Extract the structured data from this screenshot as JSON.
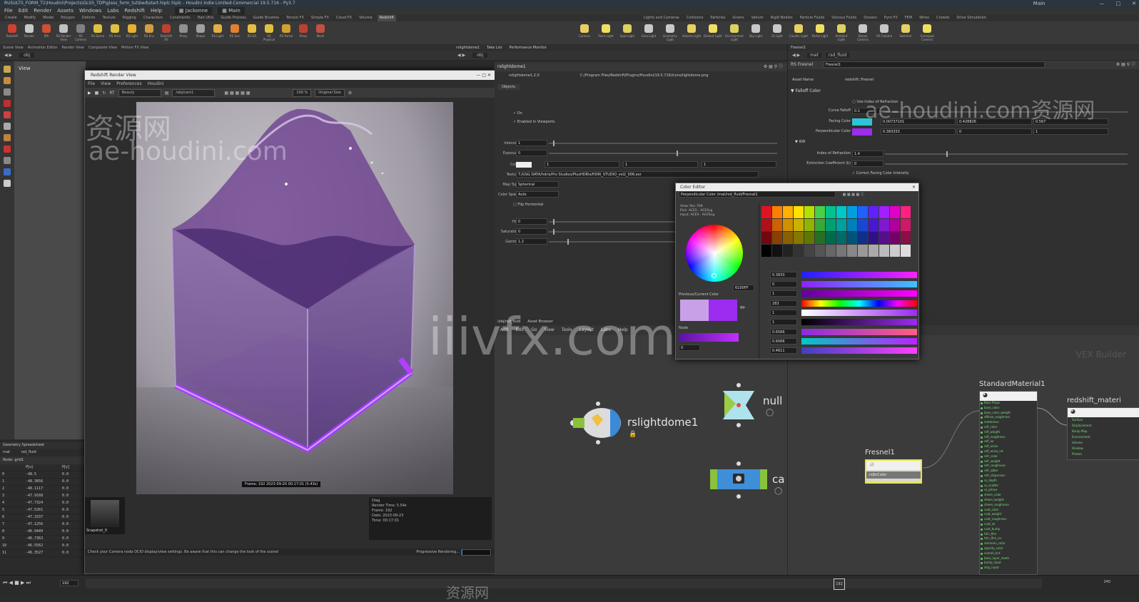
{
  "window": {
    "title": "RUSULTS_FORM_T1\\Houdini\\Projects\\GLSS_TDP\\glass_form_tut\\bed\\start.hiplc.hiplc - Houdini Indie Limited-Commercial 19.5.716 - Py3.7",
    "desktop": "Main"
  },
  "menubar": [
    "File",
    "Edit",
    "Render",
    "Assets",
    "Windows",
    "Labs",
    "Redshift",
    "Help"
  ],
  "menubar_desk": "Jackonne",
  "menubar_desk2": "Main",
  "shelf_tabs": [
    "Create",
    "Modify",
    "Model",
    "Polygon",
    "Deform",
    "Texture",
    "Rigging",
    "Characters",
    "Constraints",
    "Hair Utils",
    "Guide Process",
    "Guide Brushes",
    "Terrain FX",
    "Simple FX",
    "Cloud FX",
    "Volume",
    "Redshift"
  ],
  "shelf_tools": [
    "Redshift",
    "Render",
    "IPR",
    "RS Render View",
    "RS Camera",
    "RS Dome",
    "RS Area",
    "RS Light",
    "RS Env",
    "Redshift RS",
    "Proxy",
    "Shape",
    "RS Light",
    "RS Sun",
    "RS IES",
    "RS Physical",
    "RS Portal",
    "Proxy",
    "Mesh"
  ],
  "right_shelf_tabs": [
    "Lights and Cameras",
    "Collisions",
    "Particles",
    "Grains",
    "Vellum",
    "Rigid Bodies",
    "Particle Fluids",
    "Viscous Fluids",
    "Oceans",
    "Pyro FX",
    "FEM",
    "Wires",
    "Crowds",
    "Drive Simulation"
  ],
  "right_shelf_tools": [
    "Camera",
    "Point Light",
    "Spot Light",
    "Area Light",
    "Geometry Light",
    "Volume Light",
    "Distant Light",
    "Environment Light",
    "Sky Light",
    "GI Light",
    "Caustic Light",
    "Portal Light",
    "Ambient Light",
    "Stereo Camera",
    "VR Camera",
    "Switcher",
    "Gamepad Camera"
  ],
  "left_pane_tabs": [
    "Scene View",
    "Animation Editor",
    "Render View",
    "Composite View",
    "Motion FX View"
  ],
  "path_obj": "obj",
  "viewport_label": "View",
  "render_view": {
    "title": "Redshift Render View",
    "menu": [
      "File",
      "View",
      "Preferences",
      "Houdini"
    ],
    "rt_label": "RT",
    "beauty": "Beauty",
    "camera": "/obj/cam1",
    "zoom": "100 %",
    "size": "Original Size",
    "frame_info": "Frame: 192  2023-09-20  00:17:01  (5.43s)",
    "snapshot": "Snapshot_0",
    "stats_title": "Diag",
    "stats": [
      "Render Time: 5.54s",
      "Frame: 192",
      "Date: 2023-09-23",
      "Time: 00:17:01"
    ],
    "status_msg": "Check your Camera node OCIO display/view settings. Be aware that this can change the look of the scene!",
    "progress_label": "Progressive Rendering...",
    "progress_value": "3%"
  },
  "spreadsheet": {
    "tabs": [
      "Geometry Spreadsheet"
    ],
    "path_a": "mat",
    "path_b": "rsd_fluid",
    "node_label": "Node: grid1",
    "headers": [
      "",
      "P[x]",
      "P[y]"
    ],
    "rows": [
      [
        "0",
        "-48.5",
        "0.0"
      ],
      [
        "1",
        "-48.3856",
        "0.0"
      ],
      [
        "2",
        "-48.1117",
        "0.0"
      ],
      [
        "3",
        "-47.9168",
        "0.0"
      ],
      [
        "4",
        "-47.7324",
        "0.0"
      ],
      [
        "5",
        "-47.5261",
        "0.0"
      ],
      [
        "6",
        "-47.3337",
        "0.0"
      ],
      [
        "7",
        "-47.1256",
        "0.0"
      ],
      [
        "8",
        "-46.9449",
        "0.0"
      ],
      [
        "9",
        "-46.7363",
        "0.0"
      ],
      [
        "10",
        "-46.5562",
        "0.0"
      ],
      [
        "11",
        "-46.3527",
        "0.0"
      ]
    ]
  },
  "center_tabs": [
    "rslightdome1",
    "Take List",
    "Performance Monitor"
  ],
  "center_path": "obj",
  "param_node": "rslightdome1",
  "param_node_sub": "Redshift Dome Light",
  "param_rs": "rslightdome1.2.0",
  "param_file_hint": "C:/Program Files/Redshift/Plugins/Houdini/19.5.716/icons/lightdome.png",
  "param_tab": "Objects",
  "params": [
    {
      "name": "On",
      "value": ""
    },
    {
      "name": "Enabled in Viewports",
      "value": ""
    },
    {
      "name": "Intensity",
      "value": "1"
    },
    {
      "name": "Exposure",
      "value": "0"
    },
    {
      "name": "Color",
      "value": "1"
    },
    {
      "name": "Texture",
      "value": "T:/GSG DATA/hdris/Pro Studios/PlusHDRIs/HDRI_STUDIO_vol2_006.exr"
    },
    {
      "name": "Map Type",
      "value": "Spherical"
    },
    {
      "name": "Color Space",
      "value": "Auto"
    },
    {
      "name": "Flip Horizontal",
      "value": ""
    },
    {
      "name": "Hue",
      "value": "0"
    },
    {
      "name": "Saturation",
      "value": "0"
    },
    {
      "name": "Gamma",
      "value": "1.2"
    }
  ],
  "right_params": {
    "tab": "Fresnel1",
    "path_a": "mat",
    "path_b": "rsd_fluid",
    "node_type": "RS Fresnel",
    "node_name": "Fresnel1",
    "asset_name_label": "Asset Name",
    "asset_name_value": "redshift::Fresnel",
    "section": "Falloff Color",
    "use_ior": "Use Index of Refraction",
    "curve_falloff_label": "Curve Falloff",
    "curve_falloff": "0.1",
    "facing_label": "Facing Color",
    "facing": [
      "0.00737101",
      "0.428826",
      "0.567"
    ],
    "perp_label": "Perpendicular Color",
    "perp": [
      "0.383333",
      "0",
      "1"
    ],
    "ior_section": "IOR",
    "ior_label": "Index of Refraction",
    "ior": "1.4",
    "ext_label": "Extinction Coefficient (k)",
    "ext": "0",
    "correct_label": "Correct Facing Color Intensity"
  },
  "color_editor": {
    "title": "Color Editor",
    "path": "Perpendicular Color  /mat/rsd_fluid/Fresnel1",
    "view": "View: Rec.709",
    "pick": "Pick: ACES - ACEScg",
    "input": "Input: ACES - ACEScg",
    "hex": "6100FF",
    "prev_label": "Previous/Current Color",
    "node_label": "Node",
    "node_val": "0",
    "rgb": [
      "0.3833",
      "0",
      "1"
    ],
    "hsv": [
      "283",
      "1",
      "1"
    ],
    "tmi": [
      "0.6566",
      "0.6066",
      "0.4611"
    ],
    "palette": [
      "#e0141e",
      "#ff7f00",
      "#ffb000",
      "#ffe000",
      "#b6e000",
      "#48d048",
      "#00c48c",
      "#00c8c8",
      "#00a0e0",
      "#2060ff",
      "#6020ff",
      "#a020ff",
      "#e000c8",
      "#ff2080",
      "#b01018",
      "#d06000",
      "#d09000",
      "#c8b400",
      "#90b400",
      "#38a838",
      "#00a070",
      "#00a0a0",
      "#0080b8",
      "#1848d0",
      "#4818d0",
      "#8018d0",
      "#b0009c",
      "#d01868",
      "#700810",
      "#8a4000",
      "#8a6000",
      "#857800",
      "#607800",
      "#267026",
      "#006a4a",
      "#006a6a",
      "#005478",
      "#103088",
      "#301088",
      "#541088",
      "#740068",
      "#881044",
      "#000000",
      "#111111",
      "#222222",
      "#333333",
      "#444444",
      "#555555",
      "#666666",
      "#777777",
      "#888888",
      "#999999",
      "#aaaaaa",
      "#bbbbbb",
      "#cccccc",
      "#dddddd"
    ]
  },
  "net_tabs": [
    "/obj/rsd_fluid",
    "Asset Browser"
  ],
  "net_menu": [
    "Add",
    "Edit",
    "Go",
    "View",
    "Tools",
    "Layout",
    "Labs",
    "Help"
  ],
  "net_label": "VEX Builder",
  "nodes": {
    "dome": "rslightdome1",
    "null": "null",
    "cam": "ca",
    "std": "StandardMaterial1",
    "fresnel": "Fresnel1",
    "fresnel_port": "rslbrColor",
    "rsmat": "redshift_materi"
  },
  "std_ports": [
    "Base Props",
    "base_color",
    "base_color_weight",
    "diffuse_roughness",
    "metalness",
    "refl_color",
    "refl_weight",
    "refl_roughness",
    "refl_ior",
    "refl_aniso",
    "refl_aniso_rot",
    "refr_color",
    "refr_weight",
    "refr_roughness",
    "refr_abbe",
    "refr_dispersion",
    "ss_depth",
    "ss_scatter",
    "ss_phase",
    "sheen_color",
    "sheen_weight",
    "sheen_roughness",
    "coat_color",
    "coat_weight",
    "coat_roughness",
    "coat_ior",
    "coat_bump",
    "thin_film",
    "thin_film_ior",
    "emission_color",
    "opacity_color",
    "overall_tint",
    "base_layer_mode",
    "bump_input",
    "disp_input"
  ],
  "rsmat_ports": [
    "Surface",
    "Displacement",
    "Bump Map",
    "Environment",
    "Volume",
    "Shadow",
    "Photon"
  ],
  "timeline": {
    "frame": "192",
    "end": "240",
    "start": "1"
  },
  "watermarks": {
    "a": "资源网",
    "b": "ae-houdini.com",
    "c": "iiivfx.com",
    "d": "ae-houdini.com资源网",
    "e": "资源网"
  },
  "colors": {
    "accent_purple": "#9b2cf0",
    "facing": "#2ec4d8",
    "perp": "#7a20e8"
  }
}
